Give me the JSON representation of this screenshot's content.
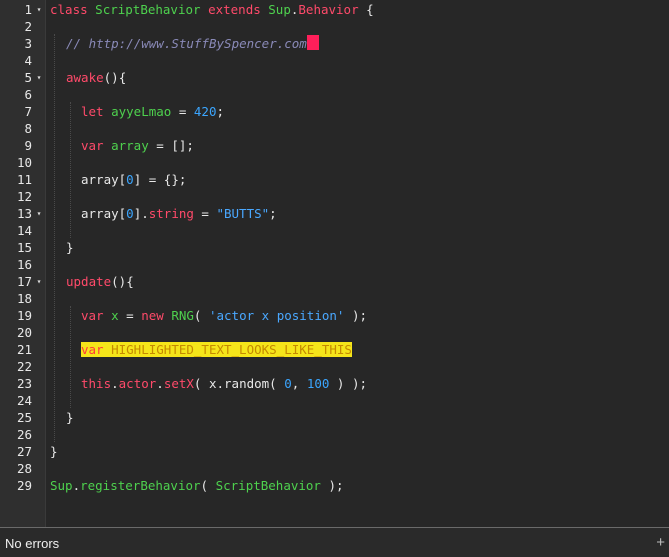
{
  "editor": {
    "line_numbers": [
      "1",
      "2",
      "3",
      "4",
      "5",
      "6",
      "7",
      "8",
      "9",
      "10",
      "11",
      "12",
      "13",
      "14",
      "15",
      "16",
      "17",
      "18",
      "19",
      "20",
      "21",
      "22",
      "23",
      "24",
      "25",
      "26",
      "27",
      "28",
      "29"
    ],
    "fold_markers": [
      "▾",
      "▾",
      "▾",
      "▾"
    ],
    "code": {
      "l1": {
        "kw1": "class",
        "name": "ScriptBehavior",
        "kw2": "extends",
        "cls": "Sup",
        "dot": ".",
        "base": "Behavior",
        "brace": " {"
      },
      "l3": {
        "comment": "// http://www.StuffBySpencer.com"
      },
      "l5": {
        "name": "awake",
        "rest": "(){"
      },
      "l7": {
        "kw": "let",
        "var": "ayyeLmao",
        "op": " = ",
        "num": "420",
        "end": ";"
      },
      "l9": {
        "kw": "var",
        "var": "array",
        "rest": " = [];"
      },
      "l11": {
        "a": "array[",
        "num": "0",
        "rest": "] = {};"
      },
      "l13": {
        "a": "array[",
        "num": "0",
        "b": "].",
        "prop": "string",
        "op": " = ",
        "str": "\"BUTTS\"",
        "end": ";"
      },
      "l15": {
        "text": "}"
      },
      "l17": {
        "name": "update",
        "rest": "(){"
      },
      "l19": {
        "kw1": "var",
        "var": "x",
        "op": " = ",
        "kw2": "new",
        "cls": "RNG",
        "open": "( ",
        "str": "'actor x position'",
        "close": " );"
      },
      "l21": {
        "kw": "var",
        "text": "HIGHLIGHTED_TEXT_LOOKS_LIKE_THIS"
      },
      "l23": {
        "kw": "this",
        "dot": ".",
        "prop": "actor",
        "dot2": ".",
        "method": "setX",
        "open": "( x.random( ",
        "n1": "0",
        "comma": ", ",
        "n2": "100",
        "close": " ) );"
      },
      "l25": {
        "text": "}"
      },
      "l27": {
        "text": "}"
      },
      "l29": {
        "cls": "Sup",
        "dot": ".",
        "method": "registerBehavior",
        "open": "( ",
        "name": "ScriptBehavior",
        "close": " );"
      }
    }
  },
  "status_bar": {
    "message": "No errors",
    "add_icon": "+"
  },
  "colors": {
    "keyword": "#ff4a6a",
    "identifier": "#4ed14e",
    "comment": "#8a8ab8",
    "number": "#3ba6ff",
    "highlight": "#f5e51a",
    "cursor": "#ff1f5a",
    "background": "#272727"
  }
}
